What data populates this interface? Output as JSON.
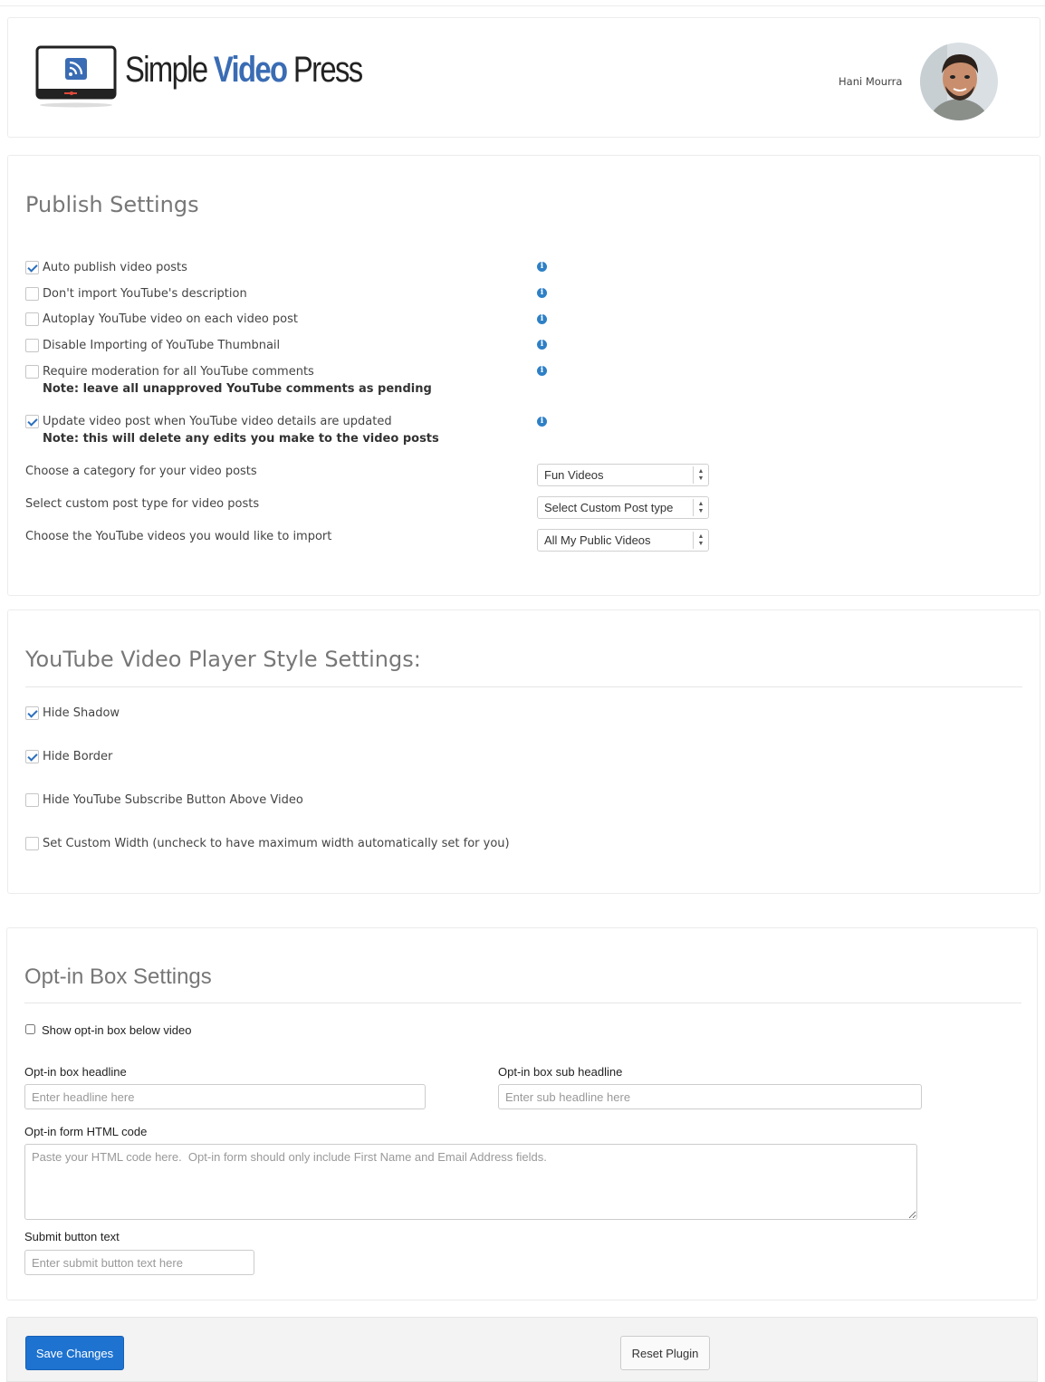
{
  "header": {
    "brand": {
      "part1": "Simple",
      "part2": "Video",
      "part3": "Press"
    },
    "username": "Hani Mourra",
    "brand_color": "#3a6cb4"
  },
  "publish": {
    "title": "Publish Settings",
    "options": [
      {
        "label": "Auto publish video posts",
        "checked": true,
        "note": ""
      },
      {
        "label": "Don't import YouTube's description",
        "checked": false,
        "note": ""
      },
      {
        "label": "Autoplay YouTube video on each video post",
        "checked": false,
        "note": ""
      },
      {
        "label": "Disable Importing of YouTube Thumbnail",
        "checked": false,
        "note": ""
      },
      {
        "label": "Require moderation for all YouTube comments",
        "checked": false,
        "note": "Note: leave all unapproved YouTube comments as pending"
      },
      {
        "label": "Update video post when YouTube video details are updated",
        "checked": true,
        "note": "Note: this will delete any edits you make to the video posts"
      }
    ],
    "category_label": "Choose a category for your video posts",
    "category_value": "Fun Videos",
    "post_type_label": "Select custom post type for video posts",
    "post_type_value": "Select Custom Post type",
    "import_label": "Choose the YouTube videos you would like to import",
    "import_value": "All My Public Videos",
    "info_icon": "info-icon"
  },
  "player": {
    "title": "YouTube Video Player Style Settings:",
    "options": [
      {
        "label": "Hide Shadow",
        "checked": true
      },
      {
        "label": "Hide Border",
        "checked": true
      },
      {
        "label": "Hide YouTube Subscribe Button Above Video",
        "checked": false
      },
      {
        "label": "Set Custom Width (uncheck to have maximum width automatically set for you)",
        "checked": false
      }
    ]
  },
  "optin": {
    "title": "Opt-in Box Settings",
    "show_label": "Show opt-in box below video",
    "headline_label": "Opt-in box headline",
    "headline_placeholder": "Enter headline here",
    "sub_headline_label": "Opt-in box sub headline",
    "sub_headline_placeholder": "Enter sub headline here",
    "html_label": "Opt-in form HTML code",
    "html_placeholder": "Paste your HTML code here.  Opt-in form should only include First Name and Email Address fields.",
    "submit_label": "Submit button text",
    "submit_placeholder": "Enter submit button text here"
  },
  "footer": {
    "save_label": "Save Changes",
    "reset_label": "Reset Plugin",
    "primary_color": "#1e73d0"
  }
}
